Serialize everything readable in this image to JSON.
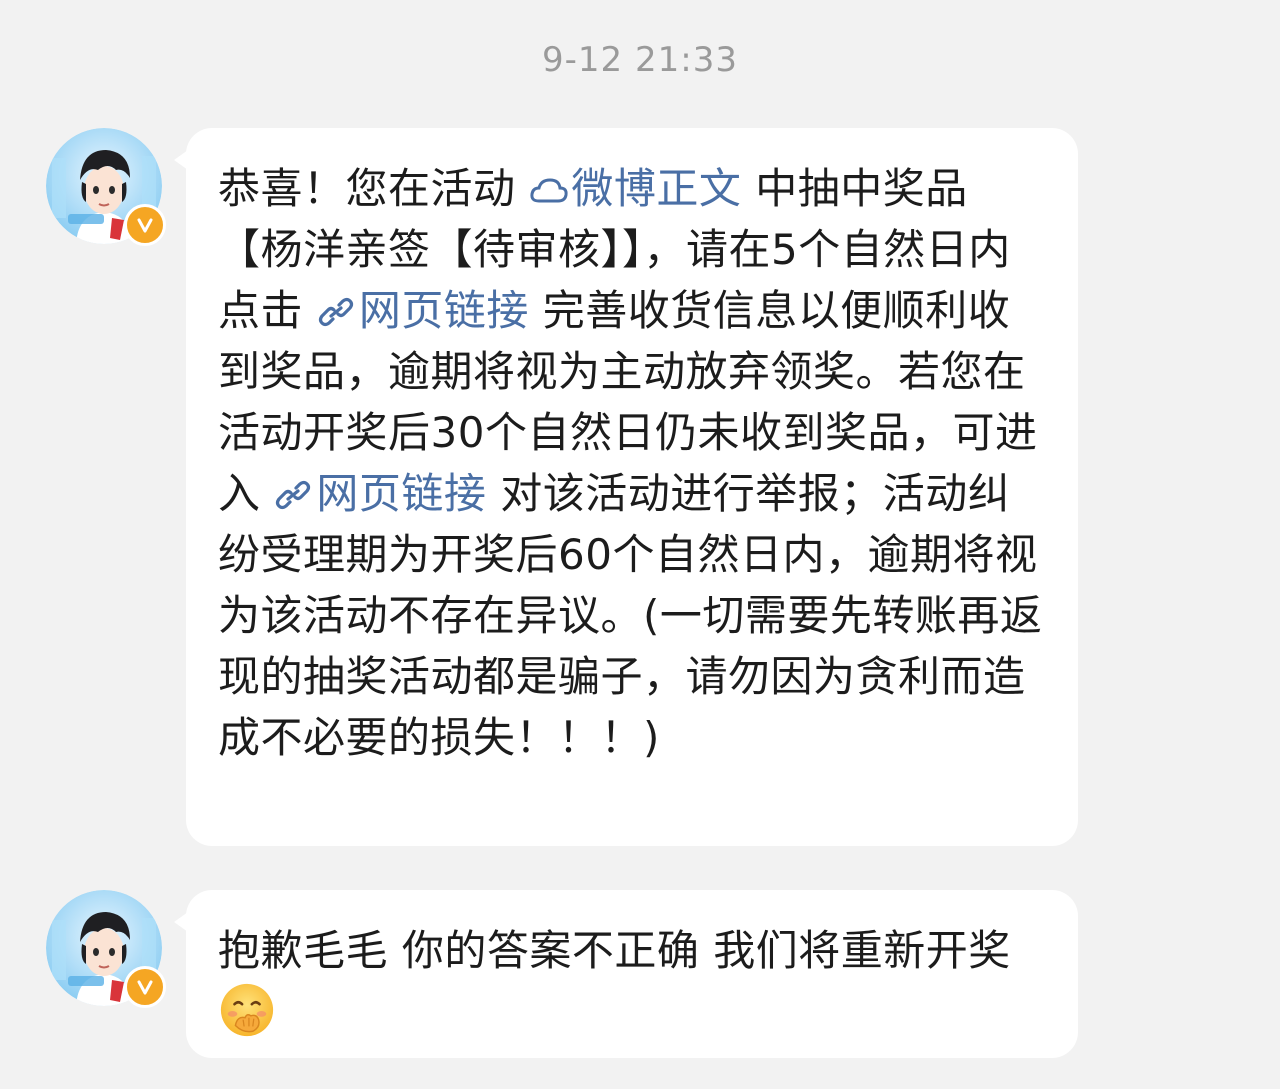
{
  "chat": {
    "timestamp": "9-12 21:33",
    "messages": [
      {
        "sender_icon": "avatar",
        "verified_badge": "V",
        "segments": {
          "p1": "恭喜！您在活动 ",
          "link1": "微博正文",
          "p2": " 中抽中奖品【杨洋亲签【待审核】】，请在5个自然日内点击 ",
          "link2": "网页链接",
          "p3": " 完善收货信息以便顺利收到奖品，逾期将视为主动放弃领奖。若您在活动开奖后30个自然日仍未收到奖品，可进入 ",
          "link3": "网页链接",
          "p4": " 对该活动进行举报；活动纠纷受理期为开奖后60个自然日内，逾期将视为该活动不存在异议。(一切需要先转账再返现的抽奖活动都是骗子，请勿因为贪利而造成不必要的损失！！！)"
        }
      },
      {
        "sender_icon": "avatar",
        "verified_badge": "V",
        "text": "抱歉毛毛 你的答案不正确 我们将重新开奖",
        "emoji_icon": "hand-over-mouth-emoji"
      }
    ]
  },
  "colors": {
    "background": "#f2f2f2",
    "bubble": "#ffffff",
    "link": "#4a6fa5",
    "text": "#1c1c1c",
    "timestamp": "#9a9a9a",
    "badge": "#f5a623"
  }
}
